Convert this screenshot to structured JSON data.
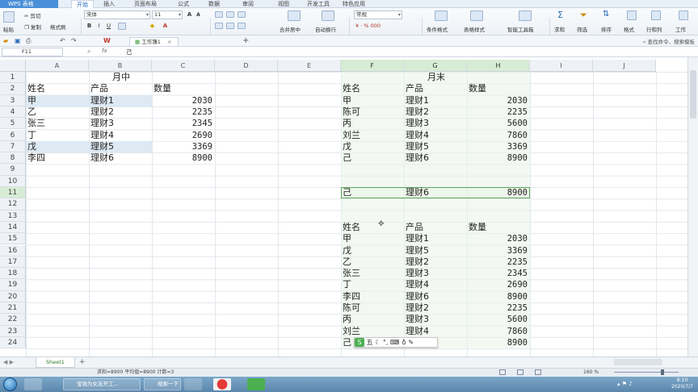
{
  "app": {
    "logo": "WPS 表格",
    "menu_tabs": [
      "开始",
      "插入",
      "页面布局",
      "公式",
      "数据",
      "审阅",
      "视图",
      "开发工具",
      "特色应用"
    ],
    "active_tab": "开始"
  },
  "ribbon": {
    "cut": "剪切",
    "copy": "复制",
    "format_painter": "格式刷",
    "paste": "粘贴",
    "font_name": "宋体",
    "font_size": "11",
    "number_format": "常规",
    "merge_center": "合并居中",
    "wrap_text": "自动换行",
    "conditional_format": "条件格式",
    "table_style": "表格样式",
    "smart_toolbox": "智能工具箱",
    "sum": "求和",
    "filter": "筛选",
    "sort": "排序",
    "format": "格式",
    "row_col": "行和列",
    "worksheet": "工作"
  },
  "doc": {
    "tab_name": "工作簿1",
    "search_placeholder": "查找命令、搜索模板"
  },
  "formula_bar": {
    "name_box": "F11",
    "fx": "fx",
    "value": "己"
  },
  "columns": [
    "A",
    "B",
    "C",
    "D",
    "E",
    "F",
    "G",
    "H",
    "I",
    "J"
  ],
  "rows": [
    "1",
    "2",
    "3",
    "4",
    "5",
    "6",
    "7",
    "8",
    "9",
    "10",
    "11",
    "12",
    "13",
    "14",
    "15",
    "16",
    "17",
    "18",
    "19",
    "20",
    "21",
    "22",
    "23",
    "24"
  ],
  "table_left": {
    "title": "月中",
    "headers": [
      "姓名",
      "产品",
      "数量"
    ],
    "rows": [
      [
        "甲",
        "理财1",
        "2030"
      ],
      [
        "乙",
        "理财2",
        "2235"
      ],
      [
        "张三",
        "理财3",
        "2345"
      ],
      [
        "丁",
        "理财4",
        "2690"
      ],
      [
        "戊",
        "理财5",
        "3369"
      ],
      [
        "李四",
        "理财6",
        "8900"
      ]
    ]
  },
  "table_right": {
    "title": "月末",
    "headers": [
      "姓名",
      "产品",
      "数量"
    ],
    "rows": [
      [
        "甲",
        "理财1",
        "2030"
      ],
      [
        "陈可",
        "理财2",
        "2235"
      ],
      [
        "丙",
        "理财3",
        "5600"
      ],
      [
        "刘兰",
        "理财4",
        "7860"
      ],
      [
        "戊",
        "理财5",
        "3369"
      ],
      [
        "己",
        "理财6",
        "8900"
      ]
    ]
  },
  "selected_row": [
    "己",
    "理财6",
    "8900"
  ],
  "table_bottom": {
    "headers": [
      "姓名",
      "产品",
      "数量"
    ],
    "rows": [
      [
        "甲",
        "理财1",
        "2030"
      ],
      [
        "戊",
        "理财5",
        "3369"
      ],
      [
        "乙",
        "理财2",
        "2235"
      ],
      [
        "张三",
        "理财3",
        "2345"
      ],
      [
        "丁",
        "理财4",
        "2690"
      ],
      [
        "李四",
        "理财6",
        "8900"
      ],
      [
        "陈可",
        "理财2",
        "2235"
      ],
      [
        "丙",
        "理财3",
        "5600"
      ],
      [
        "刘兰",
        "理财4",
        "7860"
      ],
      [
        "己",
        "",
        "8900"
      ]
    ]
  },
  "minibar_text": "五",
  "sheet_tab": "Sheet1",
  "status": {
    "stats": "求和=8900   平均值=8900   计数=3",
    "zoom": "160 %"
  },
  "taskbar": {
    "browser_item": "宝强为女友开工...",
    "search_item": "搜索一下",
    "clock_time": "8:10",
    "clock_date": "2020/7/7"
  },
  "colors": {
    "accent": "#4a8fd7",
    "selection_green": "#5aa457",
    "highlight_blue": "#dde9f3"
  }
}
